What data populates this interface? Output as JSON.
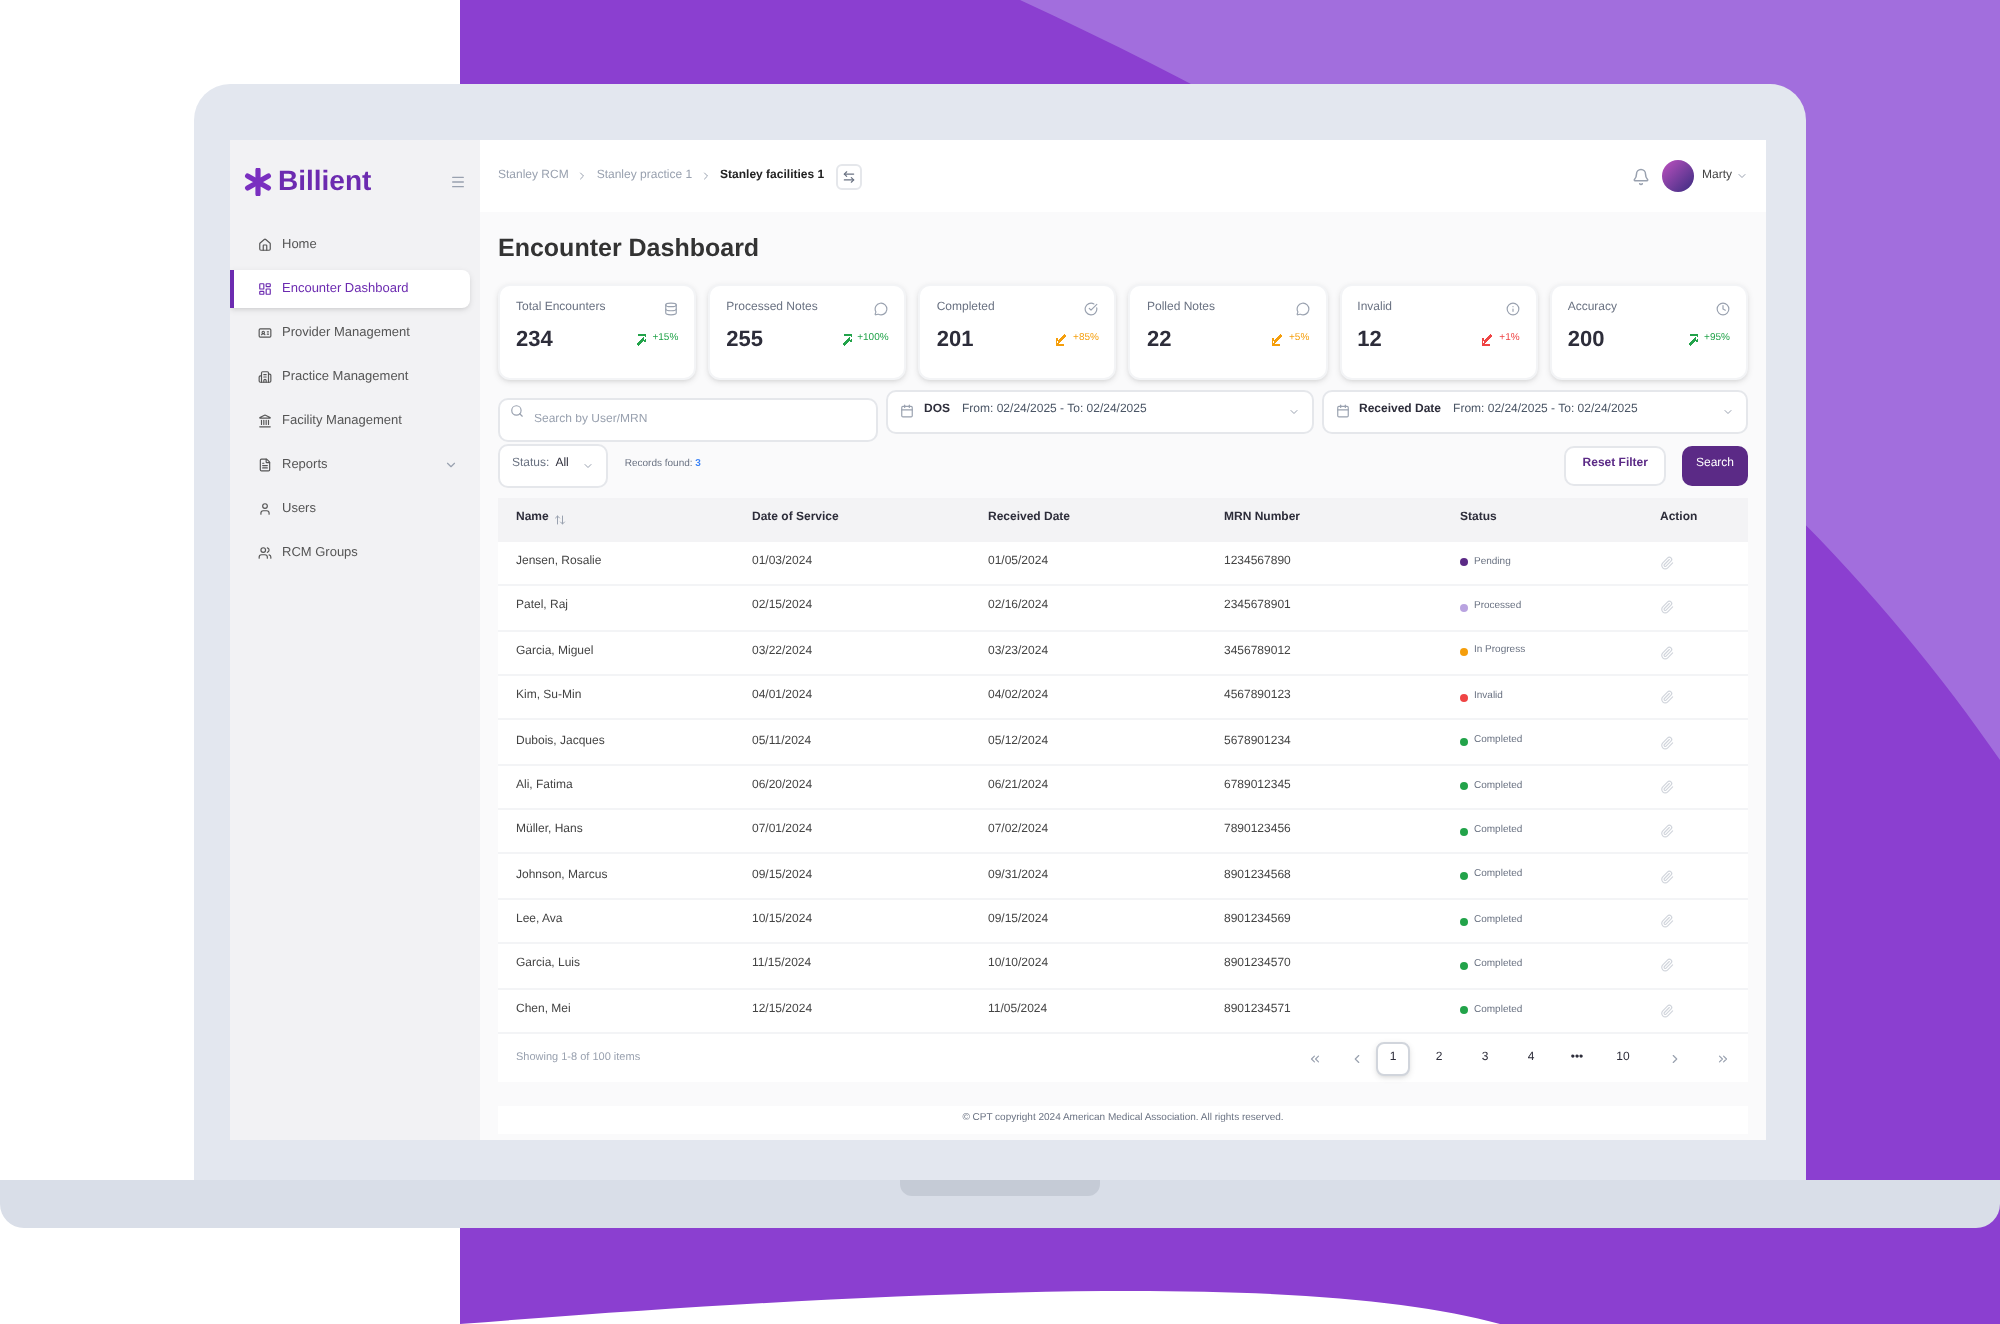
{
  "logo": "Billient",
  "breadcrumbs": [
    {
      "label": "Stanley RCM",
      "current": false
    },
    {
      "label": "Stanley practice 1",
      "current": false
    },
    {
      "label": "Stanley facilities 1",
      "current": true
    }
  ],
  "user": {
    "name": "Marty"
  },
  "sidebar": {
    "items": [
      {
        "label": "Home",
        "selected": false
      },
      {
        "label": "Encounter Dashboard",
        "selected": true
      },
      {
        "label": "Provider Management",
        "selected": false
      },
      {
        "label": "Practice Management",
        "selected": false
      },
      {
        "label": "Facility Management",
        "selected": false
      },
      {
        "label": "Reports",
        "selected": false,
        "expandable": true
      },
      {
        "label": "Users",
        "selected": false
      },
      {
        "label": "RCM Groups",
        "selected": false
      }
    ]
  },
  "title": "Encounter Dashboard",
  "stats": [
    {
      "label": "Total Encounters",
      "value": "234",
      "change": "+15%",
      "kind": "up",
      "color": "#22a34a"
    },
    {
      "label": "Processed Notes",
      "value": "255",
      "change": "+100%",
      "kind": "up",
      "color": "#22a34a"
    },
    {
      "label": "Completed",
      "value": "201",
      "change": "+85%",
      "kind": "down",
      "color": "#f59e0b"
    },
    {
      "label": "Polled Notes",
      "value": "22",
      "change": "+5%",
      "kind": "down",
      "color": "#f59e0b"
    },
    {
      "label": "Invalid",
      "value": "12",
      "change": "+1%",
      "kind": "down",
      "color": "#ef4444"
    },
    {
      "label": "Accuracy",
      "value": "200",
      "change": "+95%",
      "kind": "up",
      "color": "#22a34a"
    }
  ],
  "filters": {
    "search": {
      "placeholder": "Search by User/MRN"
    },
    "dos": {
      "label": "DOS",
      "value": "From: 02/24/2025 - To: 02/24/2025"
    },
    "received": {
      "label": "Received Date",
      "value": "From: 02/24/2025 - To: 02/24/2025"
    },
    "status": {
      "label": "Status:",
      "value": "All"
    },
    "records": {
      "label": "Records found:",
      "count": "3"
    },
    "buttons": [
      "Reset Filter",
      "Search"
    ]
  },
  "table": {
    "columns": [
      "Name",
      "Date of Service",
      "Received Date",
      "MRN Number",
      "Status",
      "Action"
    ],
    "rows": [
      {
        "name": "Jensen, Rosalie",
        "dos": "01/03/2024",
        "received": "01/05/2024",
        "mrn": "1234567890",
        "status": "Pending",
        "color": "#5b2a86"
      },
      {
        "name": "Patel, Raj",
        "dos": "02/15/2024",
        "received": "02/16/2024",
        "mrn": "2345678901",
        "status": "Processed",
        "color": "#b9a3e0"
      },
      {
        "name": "Garcia, Miguel",
        "dos": "03/22/2024",
        "received": "03/23/2024",
        "mrn": "3456789012",
        "status": "In Progress",
        "color": "#f59e0b"
      },
      {
        "name": "Kim, Su-Min",
        "dos": "04/01/2024",
        "received": "04/02/2024",
        "mrn": "4567890123",
        "status": "Invalid",
        "color": "#ef4444"
      },
      {
        "name": "Dubois, Jacques",
        "dos": "05/11/2024",
        "received": "05/12/2024",
        "mrn": "5678901234",
        "status": "Completed",
        "color": "#22a34a"
      },
      {
        "name": "Ali, Fatima",
        "dos": "06/20/2024",
        "received": "06/21/2024",
        "mrn": "6789012345",
        "status": "Completed",
        "color": "#22a34a"
      },
      {
        "name": "Müller, Hans",
        "dos": "07/01/2024",
        "received": "07/02/2024",
        "mrn": "7890123456",
        "status": "Completed",
        "color": "#22a34a"
      },
      {
        "name": "Johnson, Marcus",
        "dos": "09/15/2024",
        "received": "09/31/2024",
        "mrn": "8901234568",
        "status": "Completed",
        "color": "#22a34a"
      },
      {
        "name": "Lee, Ava",
        "dos": "10/15/2024",
        "received": "09/15/2024",
        "mrn": "8901234569",
        "status": "Completed",
        "color": "#22a34a"
      },
      {
        "name": "Garcia, Luis",
        "dos": "11/15/2024",
        "received": "10/10/2024",
        "mrn": "8901234570",
        "status": "Completed",
        "color": "#22a34a"
      },
      {
        "name": "Chen, Mei",
        "dos": "12/15/2024",
        "received": "11/05/2024",
        "mrn": "8901234571",
        "status": "Completed",
        "color": "#22a34a"
      }
    ]
  },
  "pagination": {
    "summary": "Showing 1-8 of 100 items",
    "pages": [
      {
        "label": "1",
        "selected": true
      },
      {
        "label": "2",
        "selected": false
      },
      {
        "label": "3",
        "selected": false
      },
      {
        "label": "4",
        "selected": false
      },
      {
        "label": "•••",
        "selected": false
      },
      {
        "label": "10",
        "selected": false
      }
    ]
  },
  "footer": "© CPT copyright 2024 American Medical Association. All rights reserved."
}
